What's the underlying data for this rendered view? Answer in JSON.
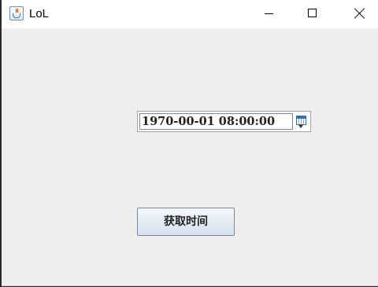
{
  "window": {
    "title": "LoL",
    "icon": "java-app-icon",
    "controls": {
      "minimize": "minimize-icon",
      "maximize": "maximize-icon",
      "close": "close-icon"
    }
  },
  "date_picker": {
    "value": "1970-00-01 08:00:00",
    "button_icon": "calendar-icon"
  },
  "action_button": {
    "label": "获取时间"
  },
  "colors": {
    "window_bg": "#eeeeee",
    "titlebar_bg": "#ffffff",
    "button_gradient_top": "#f4f7fb",
    "button_gradient_bottom": "#d7e1ed",
    "border": "#7a8a9e"
  }
}
